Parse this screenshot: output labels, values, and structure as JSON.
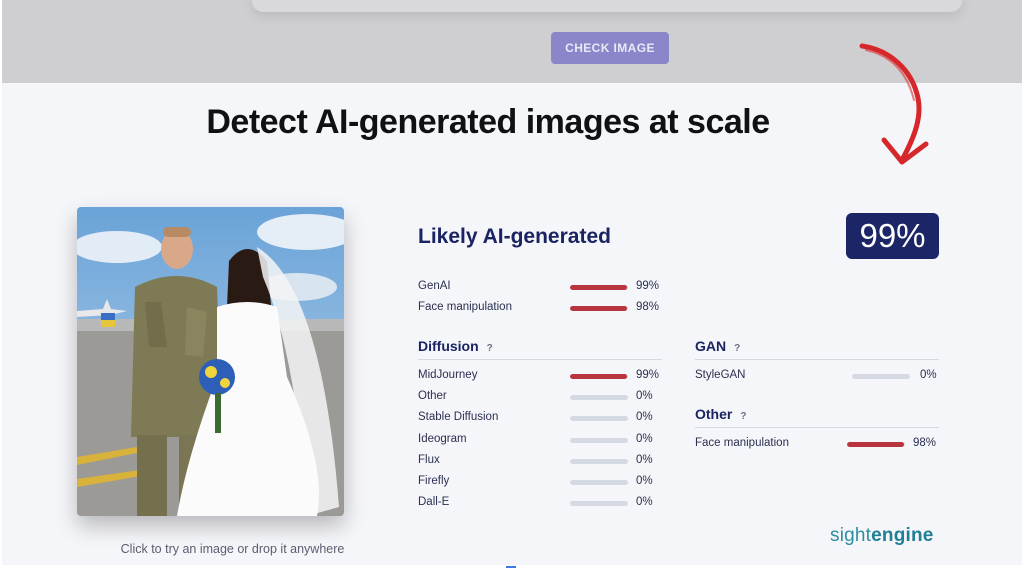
{
  "toolbar": {
    "check_button_label": "CHECK IMAGE"
  },
  "headline": "Detect AI-generated images at scale",
  "photo": {
    "hint": "Click to try an image or drop it anywhere"
  },
  "result": {
    "verdict": "Likely AI-generated",
    "score": "99%",
    "summary": [
      {
        "label": "GenAI",
        "value": "99%",
        "fraction": 0.99
      },
      {
        "label": "Face manipulation",
        "value": "98%",
        "fraction": 0.98
      }
    ]
  },
  "diffusion": {
    "title": "Diffusion",
    "help": "?",
    "items": [
      {
        "label": "MidJourney",
        "value": "99%",
        "fraction": 0.99
      },
      {
        "label": "Other",
        "value": "0%",
        "fraction": 0
      },
      {
        "label": "Stable Diffusion",
        "value": "0%",
        "fraction": 0
      },
      {
        "label": "Ideogram",
        "value": "0%",
        "fraction": 0
      },
      {
        "label": "Flux",
        "value": "0%",
        "fraction": 0
      },
      {
        "label": "Firefly",
        "value": "0%",
        "fraction": 0
      },
      {
        "label": "Dall-E",
        "value": "0%",
        "fraction": 0
      }
    ]
  },
  "gan": {
    "title": "GAN",
    "help": "?",
    "items": [
      {
        "label": "StyleGAN",
        "value": "0%",
        "fraction": 0
      }
    ]
  },
  "other": {
    "title": "Other",
    "help": "?",
    "items": [
      {
        "label": "Face manipulation",
        "value": "98%",
        "fraction": 0.98
      }
    ]
  },
  "brand": {
    "part1": "sight",
    "part2": "engine"
  },
  "colors": {
    "accent_navy": "#1c2566",
    "bar_fill_red": "#b83540",
    "bar_track": "#d4d9e3",
    "button_purple": "#8a86c9",
    "brand_teal": "#2d8ea3",
    "arrow_red": "#d6272b"
  }
}
